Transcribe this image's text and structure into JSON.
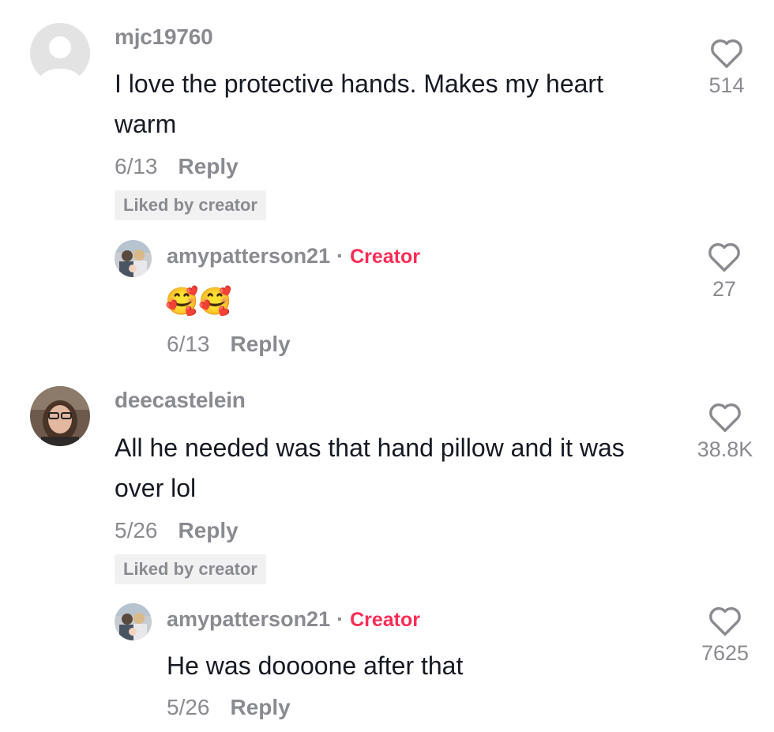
{
  "comments": [
    {
      "username": "mjc19760",
      "text_line1": "I love the protective hands. Makes my heart",
      "text_line2": "warm",
      "date": "6/13",
      "reply_label": "Reply",
      "liked_badge": "Liked by creator",
      "likes": "514",
      "avatar_icon": "default-avatar-icon",
      "reply": {
        "username": "amypatterson21",
        "separator": "·",
        "tag": "Creator",
        "text": "🥰🥰",
        "date": "6/13",
        "reply_label": "Reply",
        "likes": "27"
      }
    },
    {
      "username": "deecastelein",
      "text_line1": "All he needed was that hand pillow and it was",
      "text_line2": "over lol",
      "date": "5/26",
      "reply_label": "Reply",
      "liked_badge": "Liked by creator",
      "likes": "38.8K",
      "reply": {
        "username": "amypatterson21",
        "separator": "·",
        "tag": "Creator",
        "text": "He was doooone after that",
        "date": "5/26",
        "reply_label": "Reply",
        "likes": "7625"
      }
    }
  ],
  "colors": {
    "creator_tag": "#fe2c55",
    "muted": "#8a8b91",
    "text": "#161823",
    "badge_bg": "#f1f1f2"
  },
  "icons": [
    "heart-outline-icon",
    "smiling-face-with-hearts-emoji"
  ]
}
